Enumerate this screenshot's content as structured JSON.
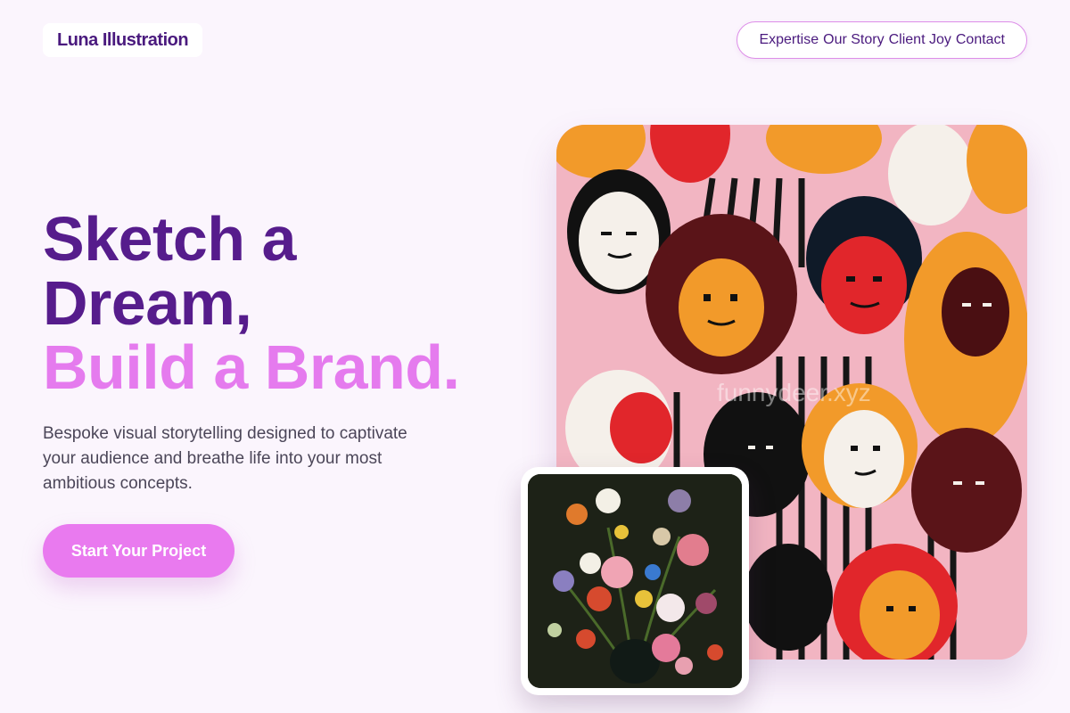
{
  "brand": {
    "name": "Luna Illustration"
  },
  "nav": {
    "items": [
      {
        "label": "Expertise"
      },
      {
        "label": "Our Story"
      },
      {
        "label": "Client Joy"
      },
      {
        "label": "Contact"
      }
    ]
  },
  "hero": {
    "headline_line1": "Sketch a",
    "headline_line2": "Dream,",
    "headline_line3": "Build a Brand.",
    "description": "Bespoke visual storytelling designed to captivate your audience and breathe life into your most ambitious concepts.",
    "cta_label": "Start Your Project"
  },
  "artwork": {
    "main_watermark": "funnydeer.xyz",
    "main_icon": "illustrated-faces-mural",
    "inset_icon": "flower-bouquet-painting"
  },
  "colors": {
    "background": "#fbf5fd",
    "headline_dark": "#561c8c",
    "headline_light": "#e57bee",
    "accent": "#e97aef",
    "nav_border": "#dd8ee8"
  }
}
